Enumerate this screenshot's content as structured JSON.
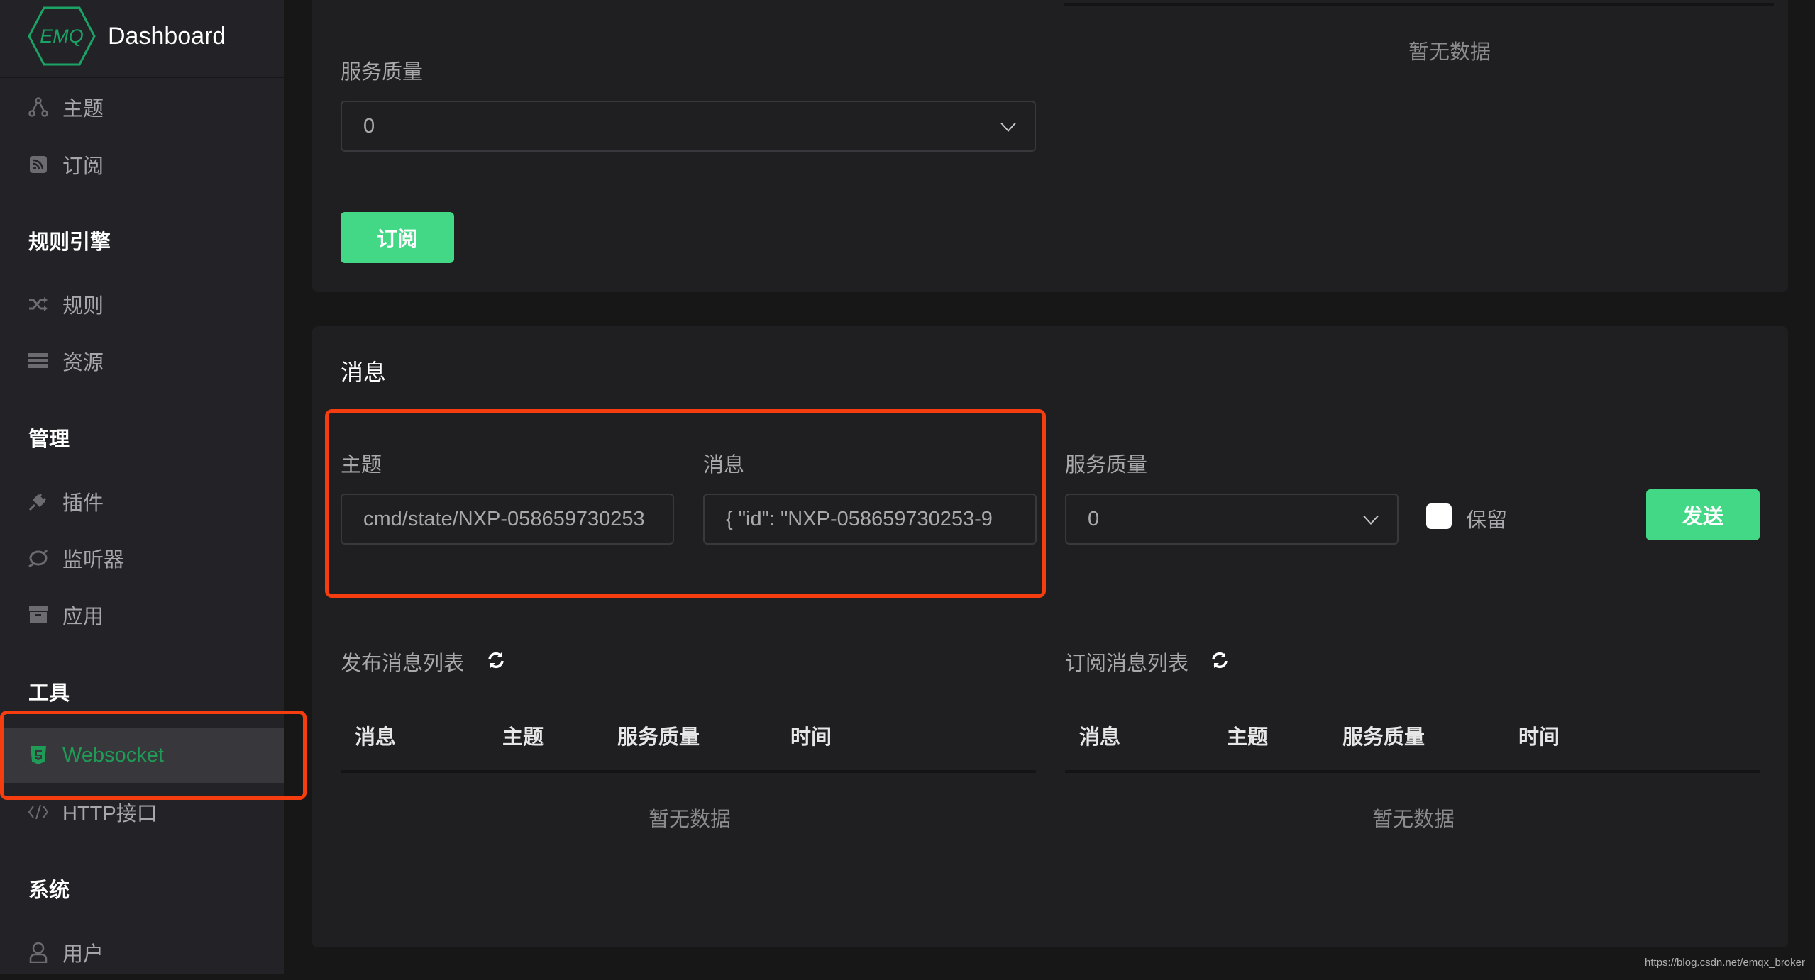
{
  "app": {
    "logo_text": "EMQ",
    "title": "Dashboard"
  },
  "sidebar": {
    "items": [
      {
        "type": "item",
        "label": "主题",
        "icon": "topic-icon"
      },
      {
        "type": "item",
        "label": "订阅",
        "icon": "rss-icon"
      },
      {
        "type": "group",
        "label": "规则引擎"
      },
      {
        "type": "item",
        "label": "规则",
        "icon": "shuffle-icon"
      },
      {
        "type": "item",
        "label": "资源",
        "icon": "server-icon"
      },
      {
        "type": "group",
        "label": "管理"
      },
      {
        "type": "item",
        "label": "插件",
        "icon": "plug-icon"
      },
      {
        "type": "item",
        "label": "监听器",
        "icon": "listener-icon"
      },
      {
        "type": "item",
        "label": "应用",
        "icon": "archive-icon"
      },
      {
        "type": "group",
        "label": "工具"
      },
      {
        "type": "item",
        "label": "Websocket",
        "icon": "html5-icon",
        "active": true
      },
      {
        "type": "item",
        "label": "HTTP接口",
        "icon": "code-icon"
      },
      {
        "type": "group",
        "label": "系统"
      },
      {
        "type": "item",
        "label": "用户",
        "icon": "user-icon"
      }
    ]
  },
  "subscribe": {
    "qos_label": "服务质量",
    "qos_value": "0",
    "subscribe_button": "订阅",
    "empty_text": "暂无数据"
  },
  "message": {
    "section_title": "消息",
    "topic_label": "主题",
    "topic_value": "cmd/state/NXP-058659730253",
    "payload_label": "消息",
    "payload_value": "{   \"id\": \"NXP-058659730253-9",
    "qos_label": "服务质量",
    "qos_value": "0",
    "retain_label": "保留",
    "retain_checked": false,
    "send_button": "发送"
  },
  "published_list": {
    "title": "发布消息列表",
    "columns": [
      "消息",
      "主题",
      "服务质量",
      "时间"
    ],
    "rows": [],
    "empty_text": "暂无数据"
  },
  "subscribed_list": {
    "title": "订阅消息列表",
    "columns": [
      "消息",
      "主题",
      "服务质量",
      "时间"
    ],
    "rows": [],
    "empty_text": "暂无数据"
  },
  "colors": {
    "accent": "#42d885",
    "active_nav": "#1f9a57",
    "highlight": "#f53d0f"
  },
  "watermark": "https://blog.csdn.net/emqx_broker"
}
